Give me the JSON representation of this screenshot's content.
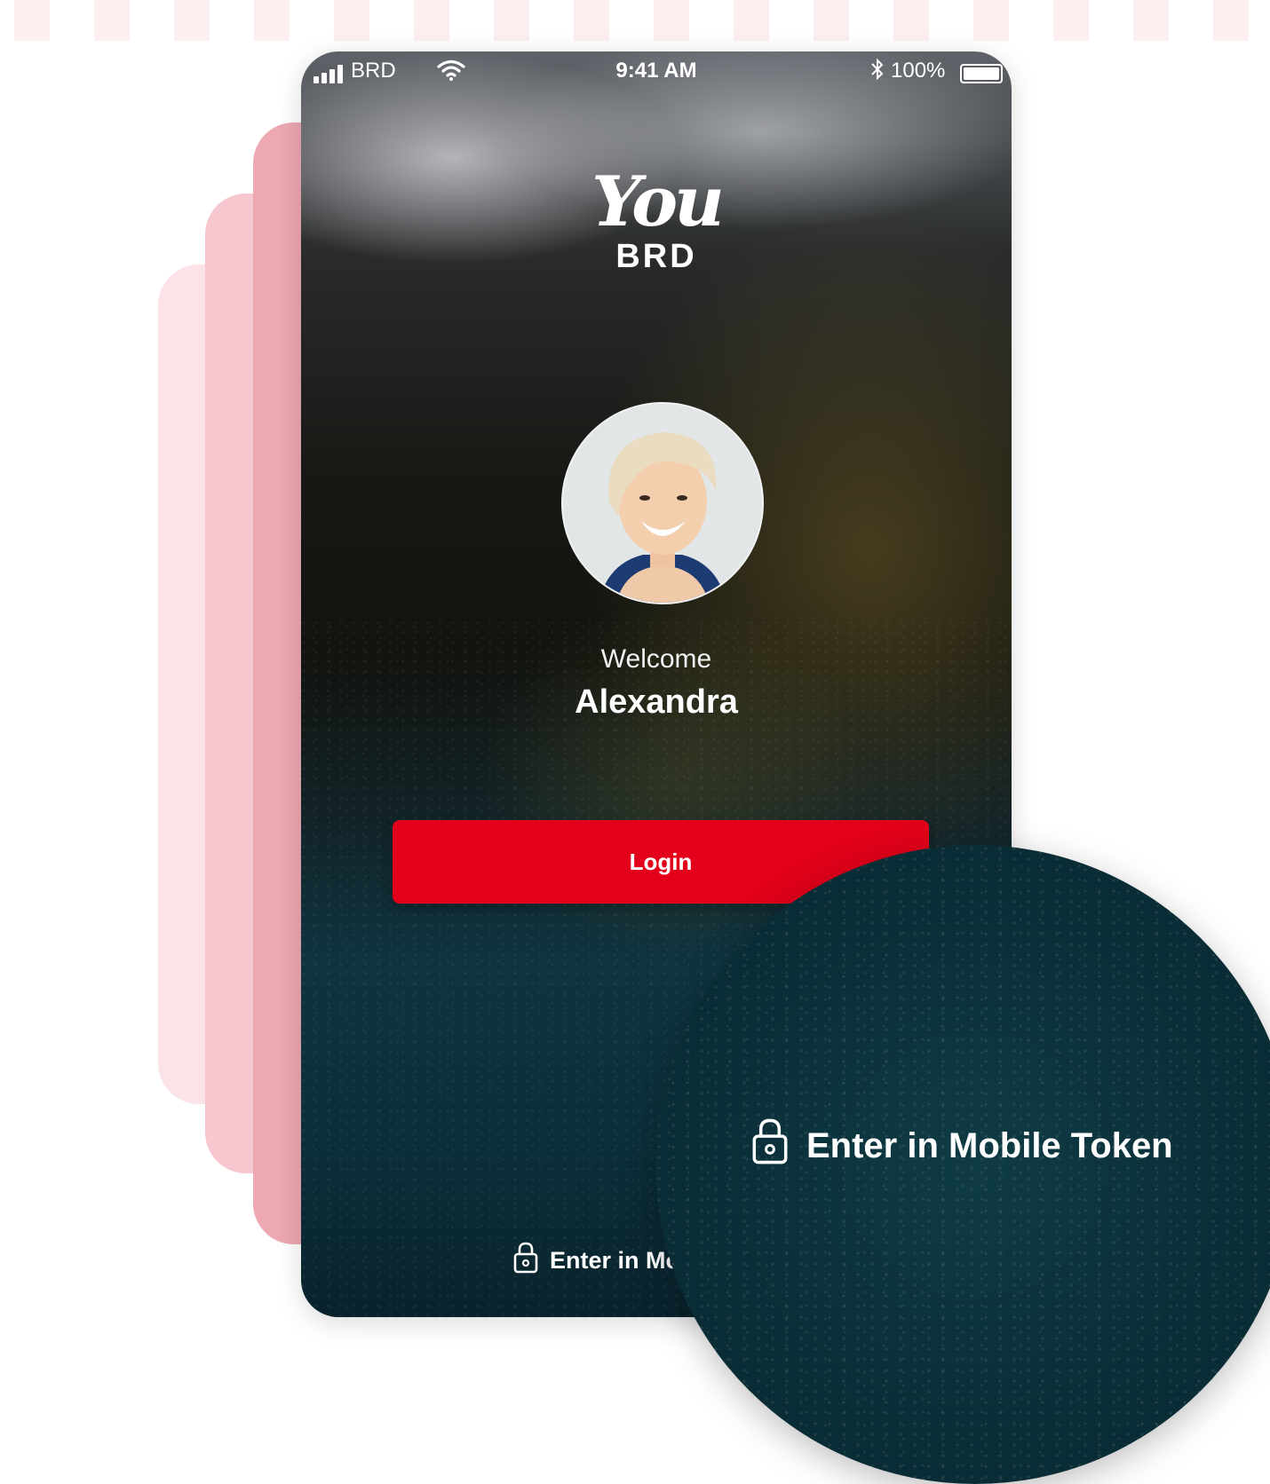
{
  "status_bar": {
    "carrier": "BRD",
    "time": "9:41 AM",
    "battery": "100%",
    "icons": [
      "signal-icon",
      "wifi-icon",
      "bluetooth-icon",
      "battery-icon"
    ]
  },
  "brand": {
    "logo_script": "You",
    "logo_name": "BRD"
  },
  "profile": {
    "welcome": "Welcome",
    "name": "Alexandra"
  },
  "actions": {
    "login_label": "Login",
    "token_label": "Enter in Mo",
    "token_label_magnified": "Enter in Mobile Token",
    "token_icon": "lock-icon"
  },
  "colors": {
    "accent": "#e2001a",
    "stack_dark": "#eda8b2",
    "stack_mid": "#f7c7cf",
    "stack_light": "#fbe3e7"
  }
}
